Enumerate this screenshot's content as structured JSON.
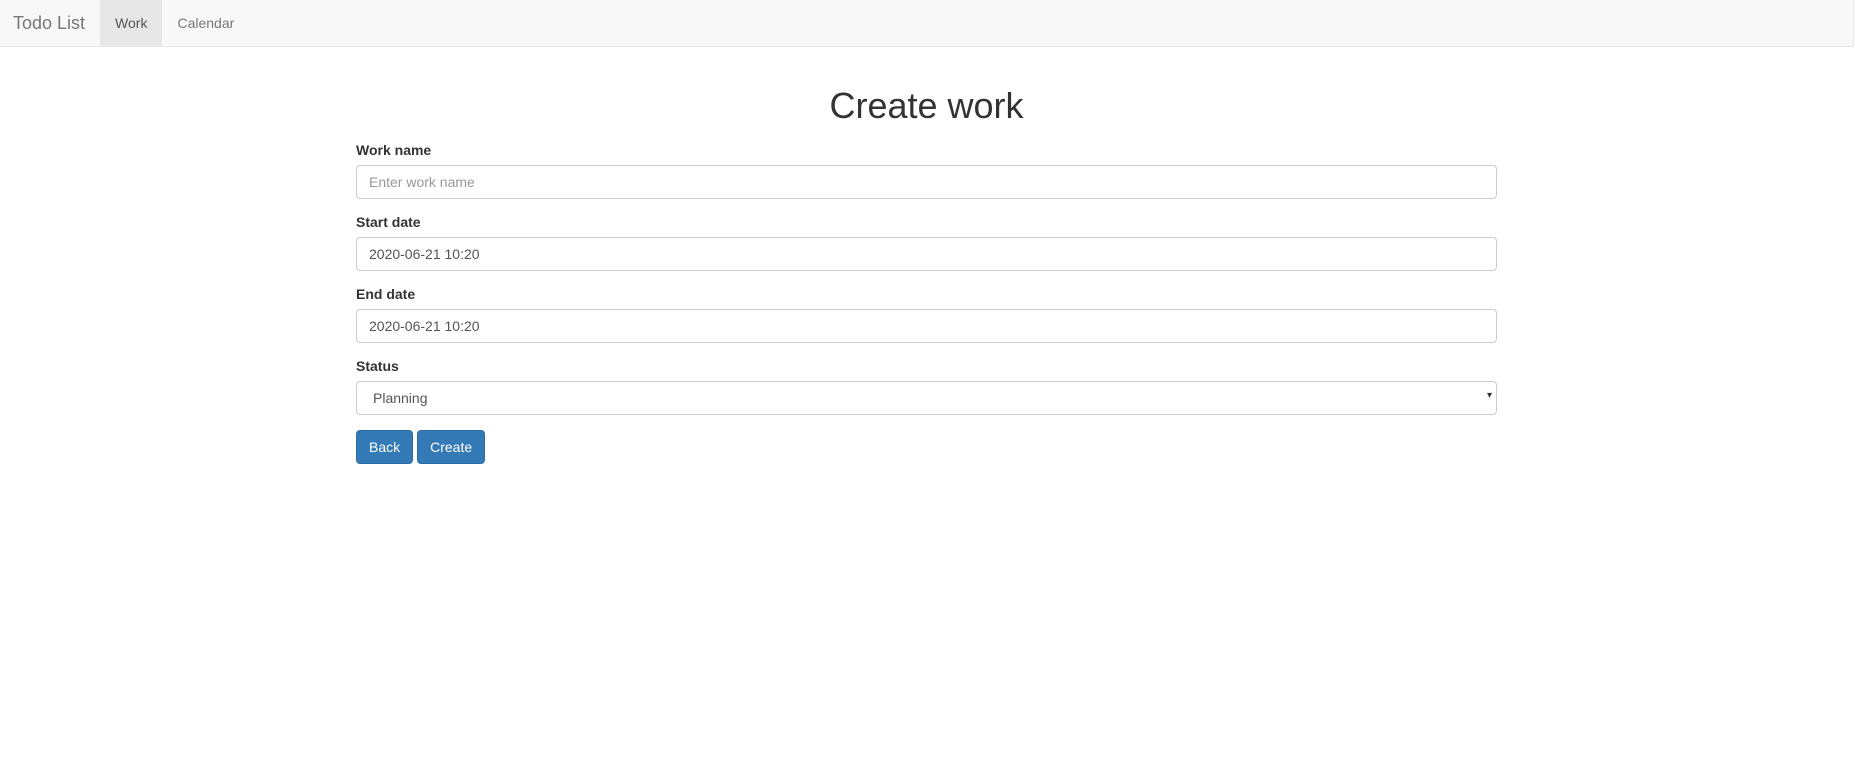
{
  "navbar": {
    "brand": "Todo List",
    "items": [
      {
        "label": "Work",
        "active": true
      },
      {
        "label": "Calendar",
        "active": false
      }
    ]
  },
  "page": {
    "title": "Create work"
  },
  "form": {
    "work_name": {
      "label": "Work name",
      "value": "",
      "placeholder": "Enter work name"
    },
    "start_date": {
      "label": "Start date",
      "value": "2020-06-21 10:20"
    },
    "end_date": {
      "label": "End date",
      "value": "2020-06-21 10:20"
    },
    "status": {
      "label": "Status",
      "selected": "Planning"
    }
  },
  "buttons": {
    "back": "Back",
    "create": "Create"
  },
  "colors": {
    "primary": "#337ab7",
    "navbar_bg": "#f8f8f8",
    "nav_active_bg": "#e7e7e7"
  }
}
